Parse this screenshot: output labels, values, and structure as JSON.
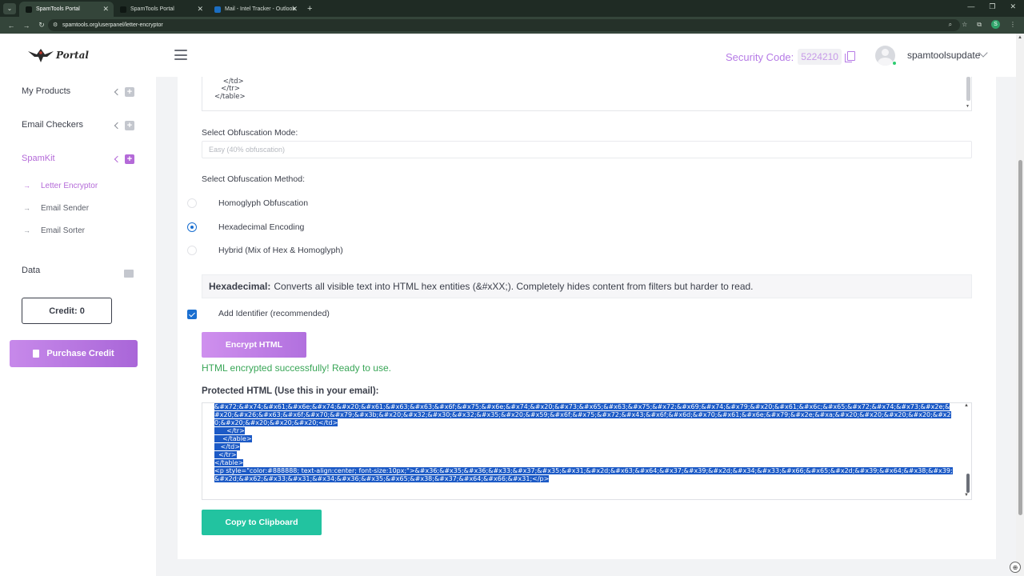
{
  "browser": {
    "tabs": [
      {
        "label": "SpamTools Portal",
        "active": true
      },
      {
        "label": "SpamTools Portal",
        "active": false
      },
      {
        "label": "Mail - Intel Tracker - Outlook",
        "active": false
      }
    ],
    "url": "spamtools.org/userpanel/letter-encryptor",
    "profile_initial": "S"
  },
  "header": {
    "logo_text": "Portal",
    "security_label": "Security Code:",
    "security_code": "5224210",
    "username": "spamtoolsupdate"
  },
  "sidebar": {
    "items": [
      {
        "label": "My Products"
      },
      {
        "label": "Email Checkers"
      },
      {
        "label": "SpamKit"
      }
    ],
    "subitems": [
      {
        "label": "Letter Encryptor"
      },
      {
        "label": "Email Sender"
      },
      {
        "label": "Email Sorter"
      }
    ],
    "data_label": "Data",
    "credit_label": "Credit: 0",
    "purchase_label": "Purchase Credit"
  },
  "main": {
    "code_lines": "      </table>\n    </td>\n   </tr>\n</table>",
    "mode_label": "Select Obfuscation Mode:",
    "mode_value": "Easy (40% obfuscation)",
    "method_label": "Select Obfuscation Method:",
    "methods": [
      {
        "label": "Homoglyph Obfuscation",
        "checked": false
      },
      {
        "label": "Hexadecimal Encoding",
        "checked": true
      },
      {
        "label": "Hybrid (Mix of Hex & Homoglyph)",
        "checked": false
      }
    ],
    "info_title": "Hexadecimal:",
    "info_text": "Converts all visible text into HTML hex entities (&#xXX;). Completely hides content from filters but harder to read.",
    "identifier_label": "Add Identifier (recommended)",
    "encrypt_label": "Encrypt HTML",
    "success_text": "HTML encrypted successfully! Ready to use.",
    "protected_label": "Protected HTML (Use this in your email):",
    "output_text": "&#x72;&#x74;&#x61;&#x6e;&#x74;&#x20;&#x61;&#x63;&#x63;&#x6f;&#x75;&#x6e;&#x74;&#x20;&#x73;&#x65;&#x63;&#x75;&#x72;&#x69;&#x74;&#x79;&#x20;&#x61;&#x6c;&#x65;&#x72;&#x74;&#x73;&#x2e;&#x20;&#x26;&#x63;&#x6f;&#x70;&#x79;&#x3b;&#x20;&#x32;&#x30;&#x32;&#x35;&#x20;&#x59;&#x6f;&#x75;&#x72;&#x43;&#x6f;&#x6d;&#x70;&#x61;&#x6e;&#x79;&#x2e;&#xa;&#x20;&#x20;&#x20;&#x20;&#x20;&#x20;&#x20;&#x20;&#x20;</td>\n      </tr>\n    </table>\n   </td>\n  </tr>\n</table>\n<p style=\"color:#888888; text-align:center; font-size:10px;\">&#x36;&#x35;&#x36;&#x33;&#x37;&#x35;&#x31;&#x2d;&#x63;&#x64;&#x37;&#x39;&#x2d;&#x34;&#x33;&#x66;&#x65;&#x2d;&#x39;&#x64;&#x38;&#x39;&#x2d;&#x62;&#x33;&#x31;&#x34;&#x36;&#x35;&#x65;&#x38;&#x37;&#x64;&#x66;&#x31;</p>",
    "copy_label": "Copy to Clipboard"
  }
}
